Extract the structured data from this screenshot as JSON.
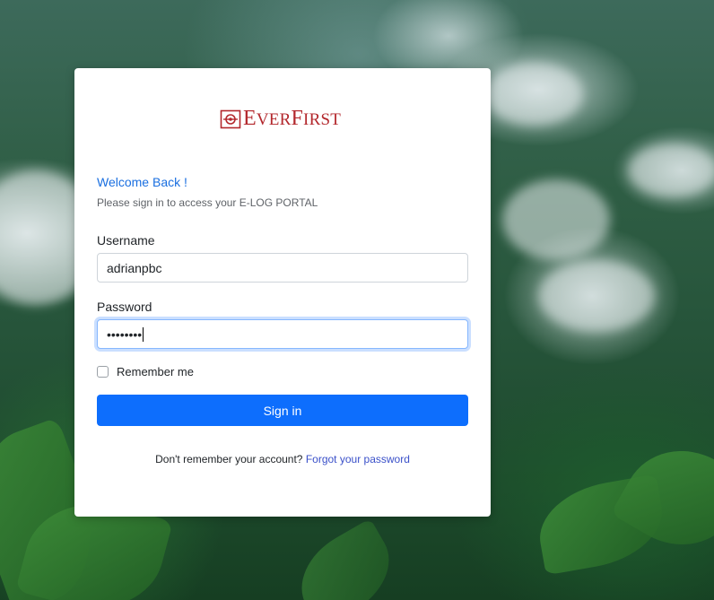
{
  "brand": {
    "logo_text": "EverFirst",
    "logo_color": "#b3282d"
  },
  "login": {
    "welcome": "Welcome Back !",
    "subtitle": "Please sign in to access your E-LOG PORTAL",
    "username_label": "Username",
    "username_value": "adrianpbc",
    "password_label": "Password",
    "password_masked": "••••••••",
    "remember_label": "Remember me",
    "remember_checked": false,
    "signin_label": "Sign in",
    "forgot_prompt": "Don't remember your account?",
    "forgot_link": "Forgot your password"
  },
  "colors": {
    "primary": "#0d6efd",
    "welcome_text": "#1a6fe0",
    "link": "#3a50c9"
  }
}
